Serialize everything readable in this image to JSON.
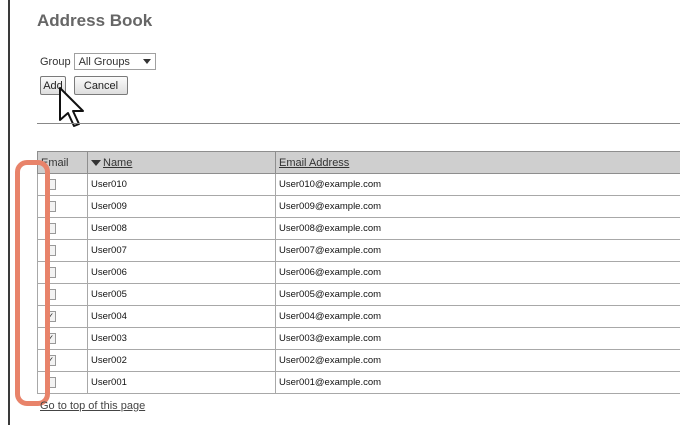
{
  "page": {
    "title": "Address Book",
    "group_label": "Group",
    "group_selected": "All Groups",
    "add_label": "Add",
    "cancel_label": "Cancel",
    "footer_link": "Go to top of this page"
  },
  "table": {
    "headers": {
      "email": "Email",
      "name": "Name",
      "address": "Email Address"
    },
    "rows": [
      {
        "name": "User010",
        "address": "User010@example.com",
        "checked": false
      },
      {
        "name": "User009",
        "address": "User009@example.com",
        "checked": false
      },
      {
        "name": "User008",
        "address": "User008@example.com",
        "checked": false
      },
      {
        "name": "User007",
        "address": "User007@example.com",
        "checked": false
      },
      {
        "name": "User006",
        "address": "User006@example.com",
        "checked": false
      },
      {
        "name": "User005",
        "address": "User005@example.com",
        "checked": false
      },
      {
        "name": "User004",
        "address": "User004@example.com",
        "checked": true
      },
      {
        "name": "User003",
        "address": "User003@example.com",
        "checked": true
      },
      {
        "name": "User002",
        "address": "User002@example.com",
        "checked": true
      },
      {
        "name": "User001",
        "address": "User001@example.com",
        "checked": false
      }
    ]
  },
  "colors": {
    "highlight": "#e8836a",
    "header_bg": "#cfcfcf"
  },
  "icons": {
    "cursor": "mouse-pointer-icon",
    "sort": "sort-down-icon",
    "dropdown": "chevron-down-icon"
  }
}
